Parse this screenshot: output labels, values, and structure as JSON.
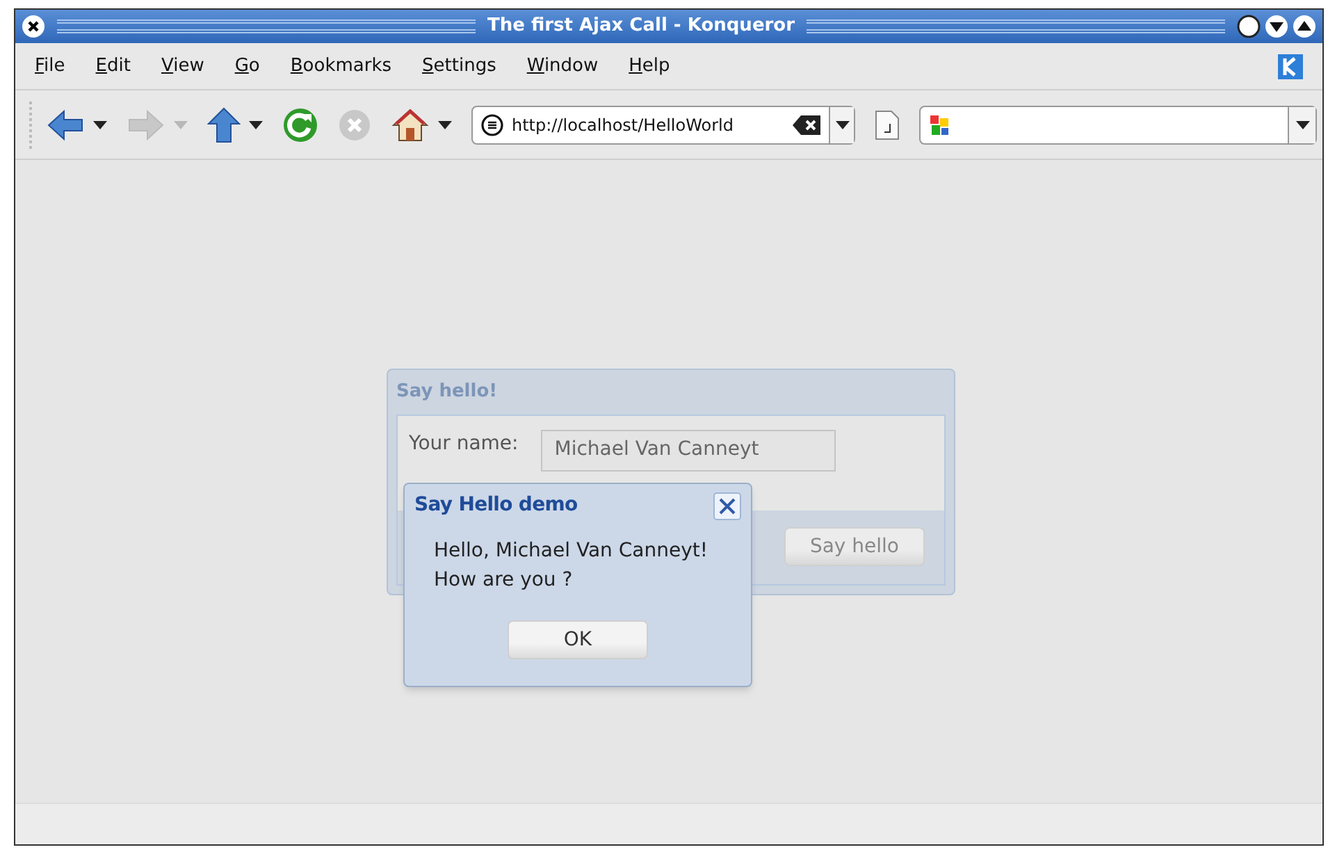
{
  "window": {
    "title": "The first Ajax Call - Konqueror"
  },
  "menu": [
    {
      "label": "File"
    },
    {
      "label": "Edit"
    },
    {
      "label": "View"
    },
    {
      "label": "Go"
    },
    {
      "label": "Bookmarks"
    },
    {
      "label": "Settings"
    },
    {
      "label": "Window"
    },
    {
      "label": "Help"
    }
  ],
  "toolbar": [
    {
      "kind": "back",
      "disabled": false
    },
    {
      "kind": "forward",
      "disabled": true
    },
    {
      "kind": "up",
      "disabled": false
    },
    {
      "kind": "reload",
      "disabled": false
    },
    {
      "kind": "stop",
      "disabled": true
    },
    {
      "kind": "home",
      "disabled": false
    }
  ],
  "address": {
    "value": "http://localhost/HelloWorld"
  },
  "panel": {
    "title": "Say hello!",
    "label": "Your name:",
    "value": "Michael Van Canneyt",
    "button": "Say hello"
  },
  "dialog": {
    "title": "Say Hello demo",
    "lines": [
      "Hello, Michael Van Canneyt!",
      "How are you ?"
    ],
    "button": "OK"
  }
}
